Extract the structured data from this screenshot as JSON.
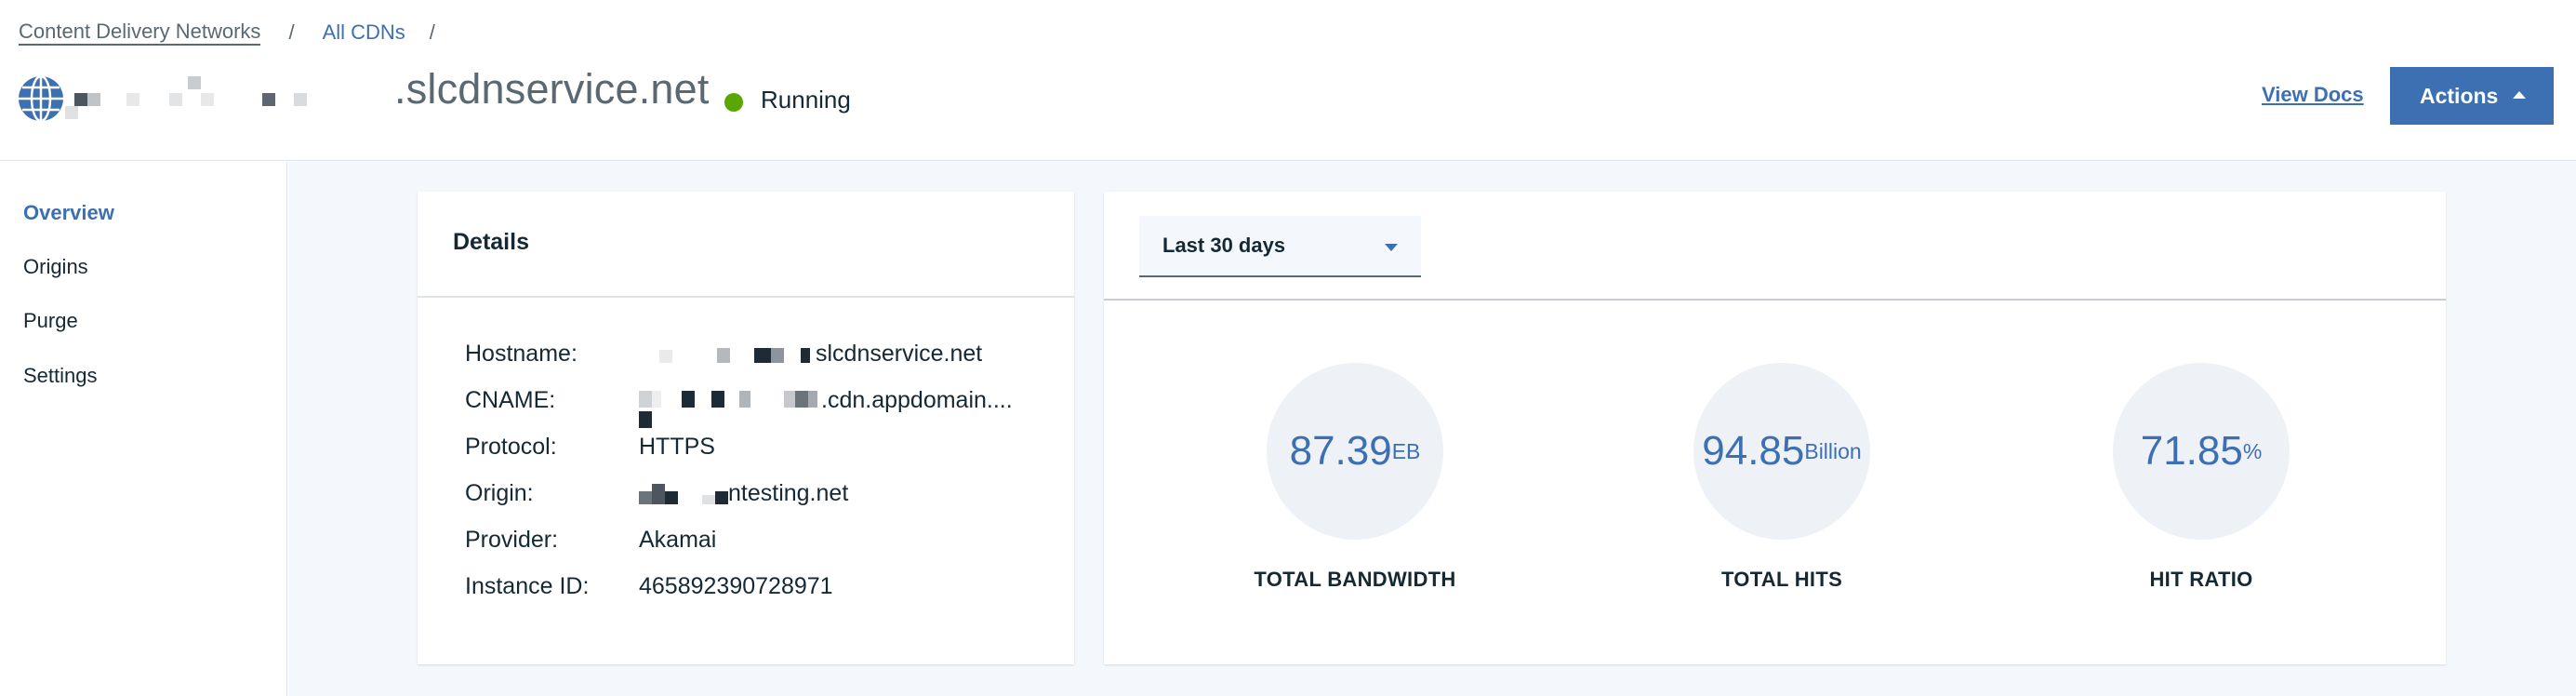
{
  "breadcrumb": {
    "items": [
      "Content Delivery Networks",
      "All CDNs"
    ],
    "separator": "/"
  },
  "header": {
    "domain_suffix": ".slcdnservice.net",
    "status": "Running",
    "view_docs_label": "View Docs",
    "actions_label": "Actions",
    "status_color": "#5aa700",
    "accent_color": "#3d70b2"
  },
  "sidebar": {
    "items": [
      {
        "label": "Overview",
        "active": true
      },
      {
        "label": "Origins",
        "active": false
      },
      {
        "label": "Purge",
        "active": false
      },
      {
        "label": "Settings",
        "active": false
      }
    ]
  },
  "details": {
    "title": "Details",
    "rows": [
      {
        "label": "Hostname:",
        "value": "slcdnservice.net"
      },
      {
        "label": "CNAME:",
        "value": ".cdn.appdomain...."
      },
      {
        "label": "Protocol:",
        "value": "HTTPS"
      },
      {
        "label": "Origin:",
        "value": "ntesting.net"
      },
      {
        "label": "Provider:",
        "value": "Akamai"
      },
      {
        "label": "Instance ID:",
        "value": "465892390728971"
      }
    ]
  },
  "metrics": {
    "range": "Last 30 days",
    "items": [
      {
        "value": "87.39",
        "unit": "EB",
        "label": "TOTAL BANDWIDTH"
      },
      {
        "value": "94.85",
        "unit": "Billion",
        "label": "TOTAL HITS"
      },
      {
        "value": "71.85",
        "unit": "%",
        "label": "HIT RATIO"
      }
    ]
  }
}
